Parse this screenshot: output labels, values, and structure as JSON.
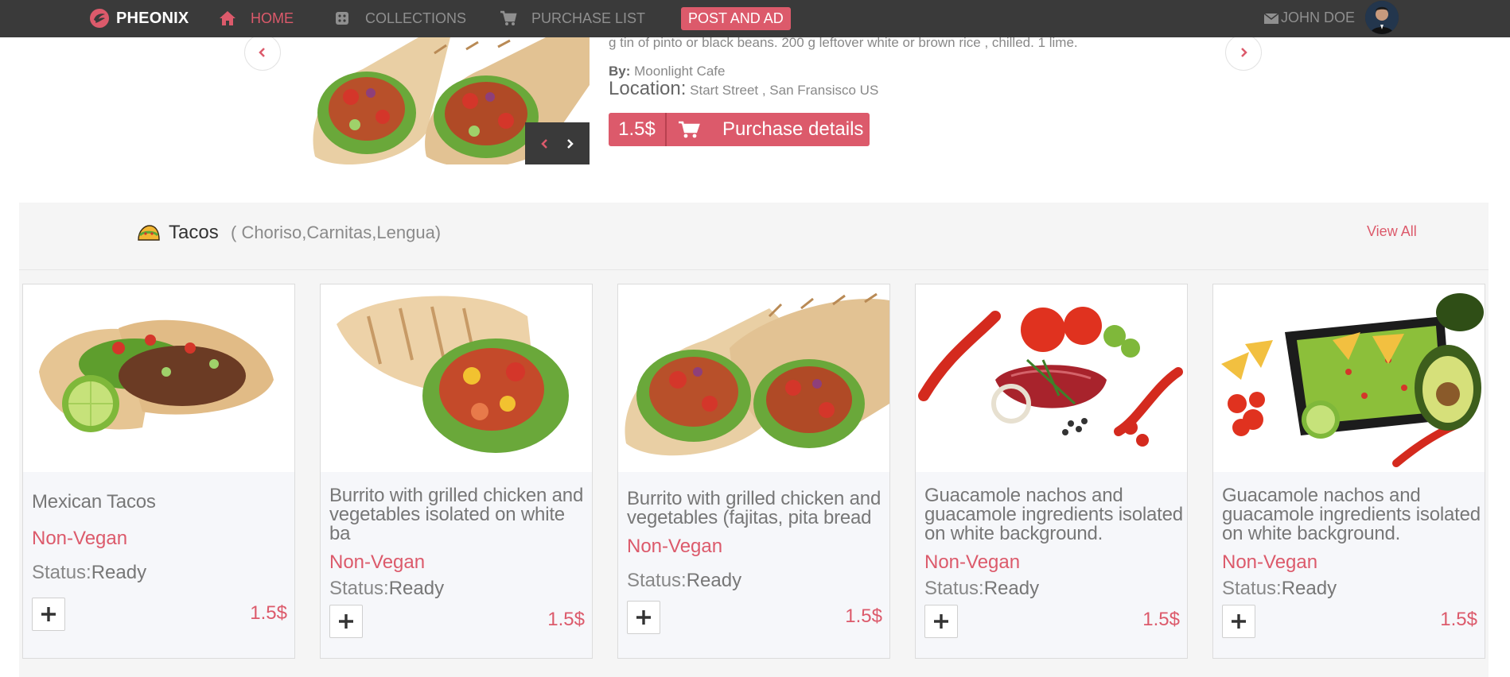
{
  "nav": {
    "brand": "PHEONIX",
    "home": "HOME",
    "collections": "COLLECTIONS",
    "purchase_list": "PURCHASE LIST",
    "post_ad": "POST AND AD",
    "user": "JOHN DOE"
  },
  "featured": {
    "description": "g tin of pinto or black beans. 200 g leftover white or brown rice , chilled. 1 lime.",
    "by_label": "By:",
    "by_value": "Moonlight Cafe",
    "location_label": "Location:",
    "location_value": "Start Street , San Fransisco US",
    "price": "1.5$",
    "button_label": "Purchase details"
  },
  "section": {
    "title": "Tacos",
    "subtitle": "( Choriso,Carnitas,Lengua)",
    "view_all": "View All"
  },
  "cards": [
    {
      "title": "Mexican Tacos",
      "diet": "Non-Vegan",
      "status_label": "Status:",
      "status_value": "Ready",
      "price": "1.5$",
      "image": "tacos"
    },
    {
      "title": "Burrito with grilled chicken and vegetables isolated on white ba",
      "diet": "Non-Vegan",
      "status_label": "Status:",
      "status_value": "Ready",
      "price": "1.5$",
      "image": "burrito"
    },
    {
      "title": "Burrito with grilled chicken and vegetables (fajitas, pita bread",
      "diet": "Non-Vegan",
      "status_label": "Status:",
      "status_value": "Ready",
      "price": "1.5$",
      "image": "burrito-halves"
    },
    {
      "title": "Guacamole nachos and guacamole ingredients isolated on white background.",
      "diet": "Non-Vegan",
      "status_label": "Status:",
      "status_value": "Ready",
      "price": "1.5$",
      "image": "meat-ingredients"
    },
    {
      "title": "Guacamole nachos and guacamole ingredients isolated on white background.",
      "diet": "Non-Vegan",
      "status_label": "Status:",
      "status_value": "Ready",
      "price": "1.5$",
      "image": "guacamole"
    }
  ],
  "colors": {
    "accent": "#dc5a6b",
    "nav_bg": "#3a3a3a",
    "section_bg": "#f5f5f5"
  }
}
